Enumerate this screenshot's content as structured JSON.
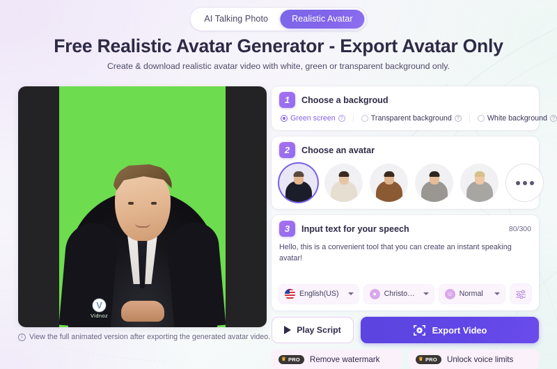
{
  "tabs": [
    {
      "label": "AI Talking Photo",
      "active": false
    },
    {
      "label": "Realistic Avatar",
      "active": true
    }
  ],
  "header": {
    "title": "Free Realistic Avatar Generator - Export Avatar Only",
    "subtitle": "Create & download realistic avatar video with white, green or transparent background only."
  },
  "preview": {
    "background_color": "#6ddc4f",
    "letterbox_color": "#232325",
    "watermark_logo": "V",
    "watermark_text": "Vidnoz",
    "note": "View the full animated version after exporting the generated avatar video.",
    "note_icon": "info-circle-icon"
  },
  "step1": {
    "number": "1",
    "title": "Choose a backgroud",
    "options": [
      {
        "label": "Green screen",
        "selected": true,
        "help_icon": "question-circle-icon"
      },
      {
        "label": "Transparent background",
        "selected": false,
        "help_icon": "question-circle-icon"
      },
      {
        "label": "White background",
        "selected": false,
        "help_icon": "question-circle-icon"
      }
    ]
  },
  "step2": {
    "number": "2",
    "title": "Choose an avatar",
    "avatars": [
      {
        "name": "avatar-1-businessman-navy-suit",
        "selected": true,
        "skin": "#e3b690",
        "hair": "#5a4a3c",
        "body": "#1b1d2a"
      },
      {
        "name": "avatar-2-woman-cream-blazer",
        "selected": false,
        "skin": "#e8c4a6",
        "hair": "#3a2a22",
        "body": "#e6ded0"
      },
      {
        "name": "avatar-3-man-brown-jacket",
        "selected": false,
        "skin": "#e0b38c",
        "hair": "#3b2a1c",
        "body": "#8a5a33"
      },
      {
        "name": "avatar-4-woman-grey-blazer",
        "selected": false,
        "skin": "#e6bd98",
        "hair": "#2e2620",
        "body": "#9a9792"
      },
      {
        "name": "avatar-5-woman-blonde-desk",
        "selected": false,
        "skin": "#eec7a4",
        "hair": "#d8c089",
        "body": "#a8a6a3"
      }
    ],
    "more_label": "more-avatars"
  },
  "step3": {
    "number": "3",
    "title": "Input text for your speech",
    "char_count": "80/300",
    "speech_text": "Hello, this is a convenient tool that you can create an instant speaking avatar!",
    "speech_placeholder": "Input text for your speech",
    "language": {
      "value": "English(US)",
      "icon": "us-flag-icon"
    },
    "voice": {
      "value": "Christoph...",
      "icon": "person-circle-icon"
    },
    "style": {
      "value": "Normal",
      "icon": "smiley-face-icon"
    },
    "settings_icon": "equalizer-sliders-icon"
  },
  "actions": {
    "play_label": "Play Script",
    "play_icon": "play-triangle-icon",
    "export_label": "Export Video",
    "export_icon": "record-frame-icon",
    "export_color": "#6046e6"
  },
  "pro_items": [
    {
      "badge": "PRO",
      "badge_icon": "crown-icon",
      "label": "Remove watermark"
    },
    {
      "badge": "PRO",
      "badge_icon": "crown-icon",
      "label": "Unlock voice limits"
    }
  ]
}
